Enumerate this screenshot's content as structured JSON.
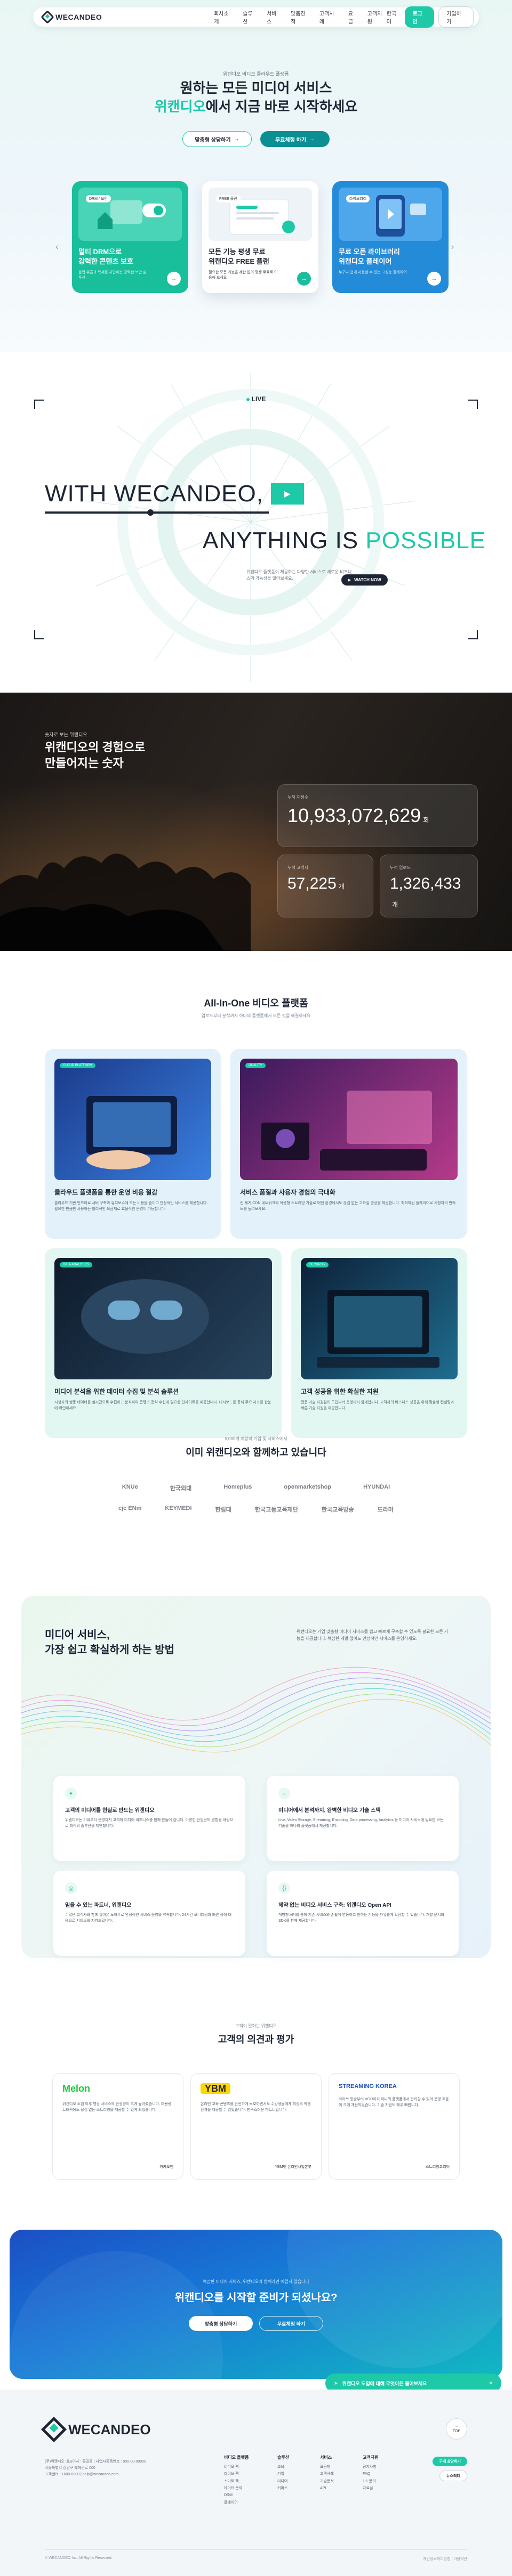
{
  "nav": {
    "brand": "WECANDEO",
    "menu": [
      "회사소개",
      "솔루션",
      "서비스",
      "맞춤견적",
      "고객사례",
      "요금",
      "고객지원"
    ],
    "lang": "한국어",
    "login": "로그인",
    "signup": "가입하기"
  },
  "hero": {
    "eyebrow": "위캔디오 비디오 클라우드 플랫폼",
    "title_l1": "원하는 모든 미디어 서비스",
    "title_accent": "위캔디오",
    "title_l2_rest": "에서 지금 바로 시작하세요",
    "btn_inquiry": "맞춤형 상담하기",
    "btn_free": "무료체험 하기",
    "cards": [
      {
        "tag": "DRM / 보안",
        "title": "멀티 DRM으로\n강력한 콘텐츠 보호",
        "desc": "불법 유출과 복제를 차단하는 강력한 보안 솔루션"
      },
      {
        "tag": "FREE 플랜",
        "title": "모든 기능 평생 무료\n위캔디오 FREE 플랜",
        "desc": "필요한 모든 기능을 제한 없이 평생 무료로 이용해 보세요"
      },
      {
        "tag": "라이브러리",
        "title": "무료 오픈 라이브러리\n위캔디오 플레이어",
        "desc": "누구나 쉽게 사용할 수 있는 고성능 플레이어"
      }
    ]
  },
  "wd": {
    "live": "LIVE",
    "line1": "WITH WECANDEO,",
    "line2a": "ANYTHING IS ",
    "line2b": "POSSIBLE",
    "desc": "위캔디오 플랫폼이 제공하는 다양한 서비스로 새로운 비즈니스의 가능성을 열어보세요.",
    "watch": "WATCH NOW"
  },
  "stats": {
    "label": "숫자로 보는 위캔디오",
    "title": "위캔디오의 경험으로\n만들어지는 숫자",
    "items": [
      {
        "k": "누적 재생수",
        "v": "10,933,072,629",
        "u": "회"
      },
      {
        "k": "누적 고객사",
        "v": "57,225",
        "u": "개"
      },
      {
        "k": "누적 업로드",
        "v": "1,326,433",
        "u": "개"
      }
    ]
  },
  "platform": {
    "title": "All-In-One 비디오 플랫폼",
    "sub": "업로드부터 분석까지 하나의 플랫폼에서 모든 것을 해결하세요",
    "cards": [
      {
        "tag": "CLOUD PLATFORM",
        "title": "클라우드 플랫폼을 통한 운영 비용 절감",
        "desc": "클라우드 기반 인프라로 서버 구축과 유지보수에 드는 비용을 줄이고 안정적인 서비스를 제공합니다. 필요한 만큼만 사용하는 합리적인 요금제로 효율적인 운영이 가능합니다."
      },
      {
        "tag": "QUALITY",
        "title": "서비스 품질과 사용자 경험의 극대화",
        "desc": "전 세계 CDN 네트워크와 적응형 스트리밍 기술로 어떤 환경에서도 끊김 없는 고화질 영상을 제공합니다. 최적화된 플레이어로 시청자의 만족도를 높여보세요."
      },
      {
        "tag": "DATA ANALYTICS",
        "title": "미디어 분석을 위한 데이터 수집 및 분석 솔루션",
        "desc": "시청자의 행동 데이터를 실시간으로 수집하고 분석하여 콘텐츠 전략 수립에 필요한 인사이트를 제공합니다. 대시보드를 통해 주요 지표를 한눈에 확인하세요."
      },
      {
        "tag": "SECURITY",
        "title": "고객 성공을 위한 확실한 지원",
        "desc": "전문 기술 지원팀이 도입부터 운영까지 함께합니다. 고객사의 비즈니스 성공을 위해 맞춤형 컨설팅과 빠른 기술 지원을 제공합니다."
      }
    ]
  },
  "clients": {
    "sub": "5,000개 이상의 기업 및 서비스에서",
    "title": "이미 위캔디오와 함께하고 있습니다",
    "row1": [
      "KNUe",
      "한국외대",
      "Homeplus",
      "openmarketshop",
      "HYUNDAI"
    ],
    "row2": [
      "cjc ENm",
      "KEYMEDI",
      "한림대",
      "한국고등교육재단",
      "한국교육방송",
      "드라마"
    ]
  },
  "how": {
    "title": "미디어 서비스,\n가장 쉽고 확실하게 하는 방법",
    "note": "위캔디오는 기업 맞춤형 미디어 서비스를 쉽고 빠르게 구축할 수 있도록 필요한 모든 기능을 제공합니다. 복잡한 개발 없이도 안정적인 서비스를 운영하세요.",
    "cards": [
      {
        "title": "고객의 미디어를 현실로 만드는 위캔디오",
        "desc": "위캔디오는 기획부터 운영까지 고객의 미디어 비즈니스를 함께 만들어 갑니다. 다양한 산업군의 경험을 바탕으로 최적의 솔루션을 제안합니다."
      },
      {
        "title": "미디어에서 분석까지, 완벽한 비디오 기술 스택",
        "desc": "Live, Video Storage, Streaming, Encoding, Data processing, Analytics 등 미디어 서비스에 필요한 모든 기술을 하나의 플랫폼에서 제공합니다."
      },
      {
        "title": "믿을 수 있는 파트너, 위캔디오",
        "desc": "수많은 고객사와 함께 쌓아온 노하우로 안정적인 서비스 운영을 약속합니다. 24시간 모니터링과 빠른 장애 대응으로 서비스를 지켜드립니다."
      },
      {
        "title": "제약 없는 비디오 서비스 구축: 위캔디오 Open API",
        "desc": "개방형 API를 통해 기존 서비스와 손쉽게 연동하고 원하는 기능을 자유롭게 확장할 수 있습니다. 개발 문서와 SDK를 함께 제공합니다."
      }
    ]
  },
  "reviews": {
    "sub": "고객이 말하는 위캔디오",
    "title": "고객의 의견과 평가",
    "items": [
      {
        "brand": "Melon",
        "desc": "위캔디오 도입 이후 영상 서비스의 안정성이 크게 높아졌습니다. 대용량 트래픽에도 끊김 없는 스트리밍을 제공할 수 있게 되었습니다.",
        "who": "카카오엔"
      },
      {
        "brand": "YBM",
        "desc": "온라인 교육 콘텐츠를 안전하게 보호하면서도 수강생들에게 최상의 학습 환경을 제공할 수 있었습니다. 만족스러운 파트너입니다.",
        "who": "YBM넷 온라인사업본부"
      },
      {
        "brand": "STREAMING KOREA",
        "desc": "라이브 방송부터 VOD까지 하나의 플랫폼에서 관리할 수 있어 운영 효율이 크게 개선되었습니다. 기술 지원도 매우 빠릅니다.",
        "who": "스트리밍코리아"
      }
    ]
  },
  "cta": {
    "q": "복잡한 미디어 서비스, 위캔디오와 함께라면 어렵지 않습니다",
    "title": "위캔디오를 시작할 준비가 되셨나요?",
    "b1": "맞춤형 상담하기",
    "b2": "무료체험 하기",
    "chat": "위캔디오 도입에 대해 무엇이든 물어보세요"
  },
  "footer": {
    "brand": "WECANDEO",
    "info": "(주)위캔디오 대표이사 : 홍길동 | 사업자등록번호 : 000-00-00000\n서울특별시 강남구 테헤란로 000\n고객센터 : 1600-0000 | help@wecandeo.com",
    "cols": [
      {
        "h": "비디오 플랫폼",
        "items": [
          "비디오 팩",
          "라이브 팩",
          "스마트 팩",
          "데이터 분석",
          "DRM",
          "플레이어"
        ]
      },
      {
        "h": "솔루션",
        "items": [
          "교육",
          "기업",
          "미디어",
          "커머스"
        ]
      },
      {
        "h": "서비스",
        "items": [
          "요금제",
          "고객사례",
          "기술문서",
          "API"
        ]
      },
      {
        "h": "고객지원",
        "items": [
          "공지사항",
          "FAQ",
          "1:1 문의",
          "자료실"
        ]
      }
    ],
    "top": "TOP",
    "contact": "구매 상담하기",
    "newsletter": "뉴스레터",
    "copy": "© WECANDEO Inc. All Rights Reserved.",
    "policy": "개인정보처리방침 | 이용약관"
  }
}
